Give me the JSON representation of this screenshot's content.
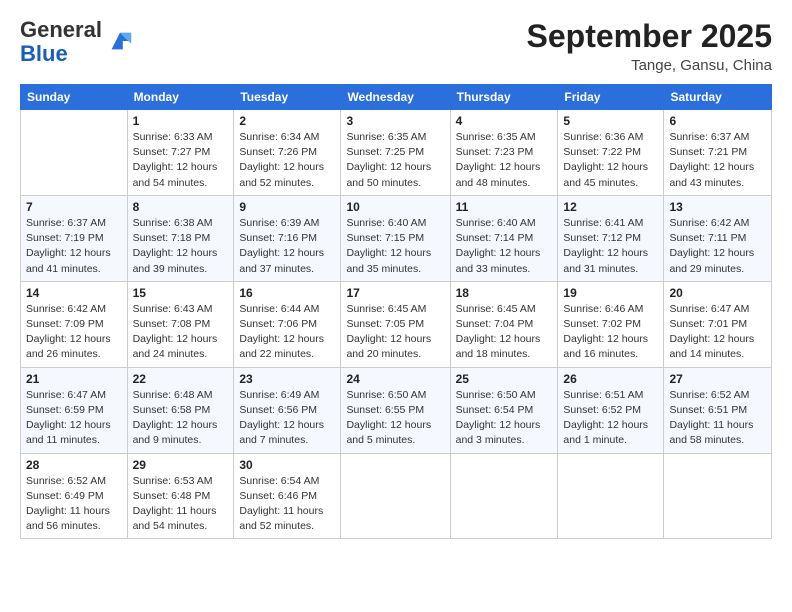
{
  "header": {
    "logo_general": "General",
    "logo_blue": "Blue",
    "title": "September 2025",
    "location": "Tange, Gansu, China"
  },
  "days_of_week": [
    "Sunday",
    "Monday",
    "Tuesday",
    "Wednesday",
    "Thursday",
    "Friday",
    "Saturday"
  ],
  "weeks": [
    [
      {
        "day": "",
        "info": ""
      },
      {
        "day": "1",
        "info": "Sunrise: 6:33 AM\nSunset: 7:27 PM\nDaylight: 12 hours\nand 54 minutes."
      },
      {
        "day": "2",
        "info": "Sunrise: 6:34 AM\nSunset: 7:26 PM\nDaylight: 12 hours\nand 52 minutes."
      },
      {
        "day": "3",
        "info": "Sunrise: 6:35 AM\nSunset: 7:25 PM\nDaylight: 12 hours\nand 50 minutes."
      },
      {
        "day": "4",
        "info": "Sunrise: 6:35 AM\nSunset: 7:23 PM\nDaylight: 12 hours\nand 48 minutes."
      },
      {
        "day": "5",
        "info": "Sunrise: 6:36 AM\nSunset: 7:22 PM\nDaylight: 12 hours\nand 45 minutes."
      },
      {
        "day": "6",
        "info": "Sunrise: 6:37 AM\nSunset: 7:21 PM\nDaylight: 12 hours\nand 43 minutes."
      }
    ],
    [
      {
        "day": "7",
        "info": "Sunrise: 6:37 AM\nSunset: 7:19 PM\nDaylight: 12 hours\nand 41 minutes."
      },
      {
        "day": "8",
        "info": "Sunrise: 6:38 AM\nSunset: 7:18 PM\nDaylight: 12 hours\nand 39 minutes."
      },
      {
        "day": "9",
        "info": "Sunrise: 6:39 AM\nSunset: 7:16 PM\nDaylight: 12 hours\nand 37 minutes."
      },
      {
        "day": "10",
        "info": "Sunrise: 6:40 AM\nSunset: 7:15 PM\nDaylight: 12 hours\nand 35 minutes."
      },
      {
        "day": "11",
        "info": "Sunrise: 6:40 AM\nSunset: 7:14 PM\nDaylight: 12 hours\nand 33 minutes."
      },
      {
        "day": "12",
        "info": "Sunrise: 6:41 AM\nSunset: 7:12 PM\nDaylight: 12 hours\nand 31 minutes."
      },
      {
        "day": "13",
        "info": "Sunrise: 6:42 AM\nSunset: 7:11 PM\nDaylight: 12 hours\nand 29 minutes."
      }
    ],
    [
      {
        "day": "14",
        "info": "Sunrise: 6:42 AM\nSunset: 7:09 PM\nDaylight: 12 hours\nand 26 minutes."
      },
      {
        "day": "15",
        "info": "Sunrise: 6:43 AM\nSunset: 7:08 PM\nDaylight: 12 hours\nand 24 minutes."
      },
      {
        "day": "16",
        "info": "Sunrise: 6:44 AM\nSunset: 7:06 PM\nDaylight: 12 hours\nand 22 minutes."
      },
      {
        "day": "17",
        "info": "Sunrise: 6:45 AM\nSunset: 7:05 PM\nDaylight: 12 hours\nand 20 minutes."
      },
      {
        "day": "18",
        "info": "Sunrise: 6:45 AM\nSunset: 7:04 PM\nDaylight: 12 hours\nand 18 minutes."
      },
      {
        "day": "19",
        "info": "Sunrise: 6:46 AM\nSunset: 7:02 PM\nDaylight: 12 hours\nand 16 minutes."
      },
      {
        "day": "20",
        "info": "Sunrise: 6:47 AM\nSunset: 7:01 PM\nDaylight: 12 hours\nand 14 minutes."
      }
    ],
    [
      {
        "day": "21",
        "info": "Sunrise: 6:47 AM\nSunset: 6:59 PM\nDaylight: 12 hours\nand 11 minutes."
      },
      {
        "day": "22",
        "info": "Sunrise: 6:48 AM\nSunset: 6:58 PM\nDaylight: 12 hours\nand 9 minutes."
      },
      {
        "day": "23",
        "info": "Sunrise: 6:49 AM\nSunset: 6:56 PM\nDaylight: 12 hours\nand 7 minutes."
      },
      {
        "day": "24",
        "info": "Sunrise: 6:50 AM\nSunset: 6:55 PM\nDaylight: 12 hours\nand 5 minutes."
      },
      {
        "day": "25",
        "info": "Sunrise: 6:50 AM\nSunset: 6:54 PM\nDaylight: 12 hours\nand 3 minutes."
      },
      {
        "day": "26",
        "info": "Sunrise: 6:51 AM\nSunset: 6:52 PM\nDaylight: 12 hours\nand 1 minute."
      },
      {
        "day": "27",
        "info": "Sunrise: 6:52 AM\nSunset: 6:51 PM\nDaylight: 11 hours\nand 58 minutes."
      }
    ],
    [
      {
        "day": "28",
        "info": "Sunrise: 6:52 AM\nSunset: 6:49 PM\nDaylight: 11 hours\nand 56 minutes."
      },
      {
        "day": "29",
        "info": "Sunrise: 6:53 AM\nSunset: 6:48 PM\nDaylight: 11 hours\nand 54 minutes."
      },
      {
        "day": "30",
        "info": "Sunrise: 6:54 AM\nSunset: 6:46 PM\nDaylight: 11 hours\nand 52 minutes."
      },
      {
        "day": "",
        "info": ""
      },
      {
        "day": "",
        "info": ""
      },
      {
        "day": "",
        "info": ""
      },
      {
        "day": "",
        "info": ""
      }
    ]
  ]
}
